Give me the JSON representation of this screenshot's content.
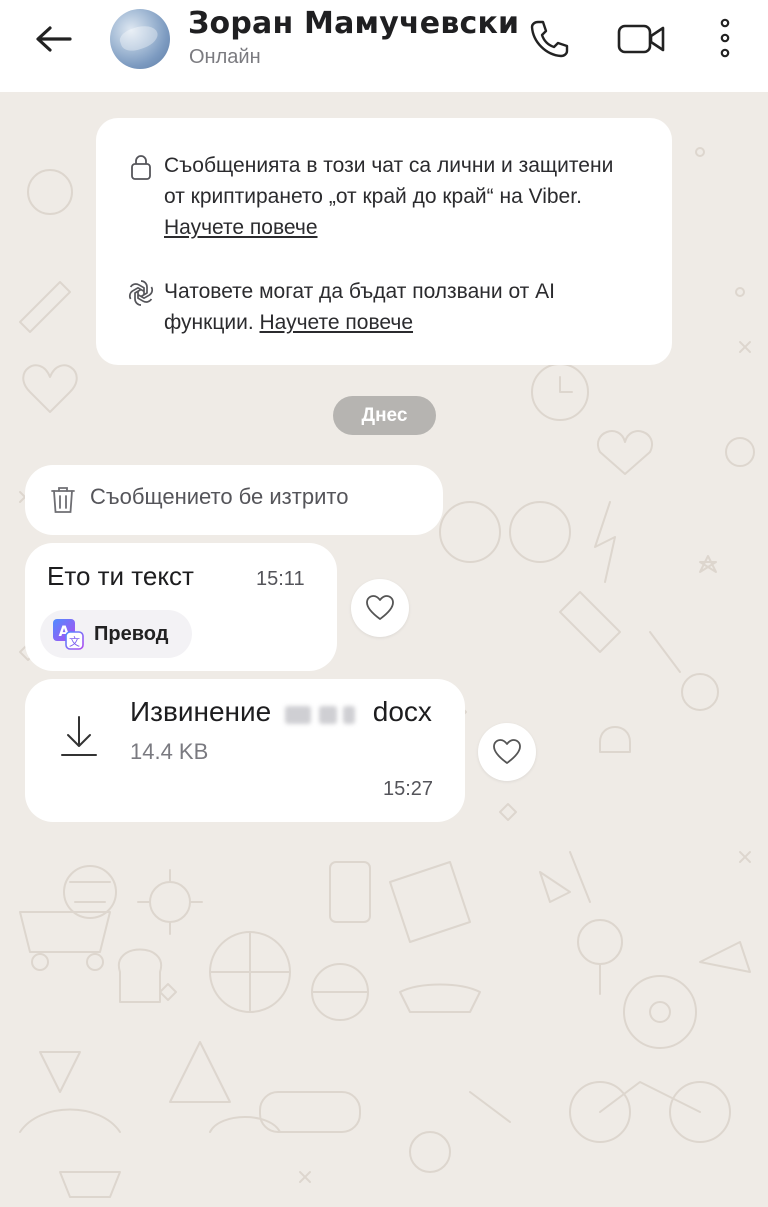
{
  "header": {
    "contact_name": "Зоран Мамучевски",
    "status": "Онлайн",
    "icons": {
      "back": "back-arrow-icon",
      "call": "phone-icon",
      "video": "video-camera-icon",
      "more": "more-vertical-icon"
    }
  },
  "notices": {
    "encryption_text": "Съобщенията в този чат са лични и защитени от криптирането „от край до край“ на Viber.",
    "encryption_link": "Научете повече",
    "ai_text": "Чатовете могат да бъдат ползвани от AI функции.",
    "ai_link": "Научете повече"
  },
  "date_separator": "Днес",
  "messages": {
    "deleted": {
      "text": "Съобщението бе изтрито"
    },
    "text_message": {
      "text": "Ето ти текст",
      "time": "15:11",
      "translate_label": "Превод"
    },
    "file_message": {
      "name_start": "Извинение",
      "name_end": "docx",
      "size": "14.4 KB",
      "time": "15:27"
    }
  },
  "colors": {
    "background": "#efebe6",
    "bubble": "#ffffff",
    "date_pill": "#b6b4b1",
    "translate_accent": "#7b5cf0"
  }
}
